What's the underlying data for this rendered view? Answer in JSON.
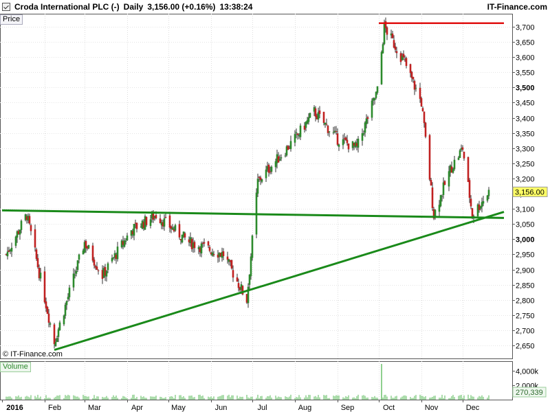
{
  "header": {
    "instrument": "Croda International PLC (-)",
    "period": "Daily",
    "price": "3,156.00 (+0.16%)",
    "time": "13:38:24",
    "brand": "IT-Finance.com"
  },
  "panels": {
    "price_label": "Price",
    "volume_label": "Volume",
    "copyright": "© IT-Finance.com"
  },
  "colors": {
    "up": "#2c8a2c",
    "down": "#c02020",
    "trend_green": "#1a8a1a",
    "resistance_red": "#e01010",
    "last_price_bg": "#ffff66",
    "volume": "#8fd08f"
  },
  "chart_data": {
    "type": "candlestick",
    "x_axis": {
      "labels": [
        "2016",
        "Feb",
        "Mar",
        "Apr",
        "May",
        "Jun",
        "Jul",
        "Aug",
        "Sep",
        "Oct",
        "Nov",
        "Dec"
      ]
    },
    "y_axis": {
      "ylim": [
        2600,
        3730
      ],
      "ticks": [
        "3,700",
        "3,650",
        "3,600",
        "3,550",
        "3,500",
        "3,450",
        "3,400",
        "3,350",
        "3,300",
        "3,250",
        "3,200",
        "3,150",
        "3,100",
        "3,050",
        "3,000",
        "2,950",
        "2,900",
        "2,850",
        "2,800",
        "2,750",
        "2,700",
        "2,650"
      ],
      "bold_ticks": [
        "3,500",
        "3,000"
      ]
    },
    "last_price": "3,156.00",
    "key_points": [
      {
        "date": "2016-01-04",
        "close": 2950
      },
      {
        "date": "2016-01-19",
        "close": 3080
      },
      {
        "date": "2016-02-08",
        "close": 2660
      },
      {
        "date": "2016-03-01",
        "close": 2990
      },
      {
        "date": "2016-03-14",
        "close": 2880
      },
      {
        "date": "2016-04-04",
        "close": 3030
      },
      {
        "date": "2016-04-22",
        "close": 3080
      },
      {
        "date": "2016-05-16",
        "close": 2990
      },
      {
        "date": "2016-06-10",
        "close": 2950
      },
      {
        "date": "2016-06-27",
        "close": 2800
      },
      {
        "date": "2016-07-05",
        "close": 3190
      },
      {
        "date": "2016-08-01",
        "close": 3330
      },
      {
        "date": "2016-08-15",
        "close": 3420
      },
      {
        "date": "2016-09-01",
        "close": 3330
      },
      {
        "date": "2016-09-15",
        "close": 3300
      },
      {
        "date": "2016-09-30",
        "close": 3490
      },
      {
        "date": "2016-10-05",
        "close": 3700
      },
      {
        "date": "2016-10-20",
        "close": 3580
      },
      {
        "date": "2016-11-01",
        "close": 3450
      },
      {
        "date": "2016-11-10",
        "close": 3080
      },
      {
        "date": "2016-11-22",
        "close": 3230
      },
      {
        "date": "2016-12-01",
        "close": 3300
      },
      {
        "date": "2016-12-08",
        "close": 3080
      },
      {
        "date": "2016-12-20",
        "close": 3156
      }
    ],
    "annotations": [
      {
        "type": "horizontal",
        "color": "red",
        "y": 3712,
        "x_from": "2016-10-01",
        "x_to": "2016-12-31"
      },
      {
        "type": "trendline",
        "color": "green",
        "points": [
          [
            "2016-01-01",
            3095
          ],
          [
            "2016-12-31",
            3070
          ]
        ]
      },
      {
        "type": "trendline",
        "color": "green",
        "points": [
          [
            "2016-02-08",
            2635
          ],
          [
            "2016-12-31",
            3090
          ]
        ]
      }
    ],
    "volume": {
      "ticks": [
        "4,000k",
        "2,000k"
      ],
      "last": "270,339",
      "spike": {
        "date": "2016-10-03",
        "value": 5000
      }
    }
  }
}
